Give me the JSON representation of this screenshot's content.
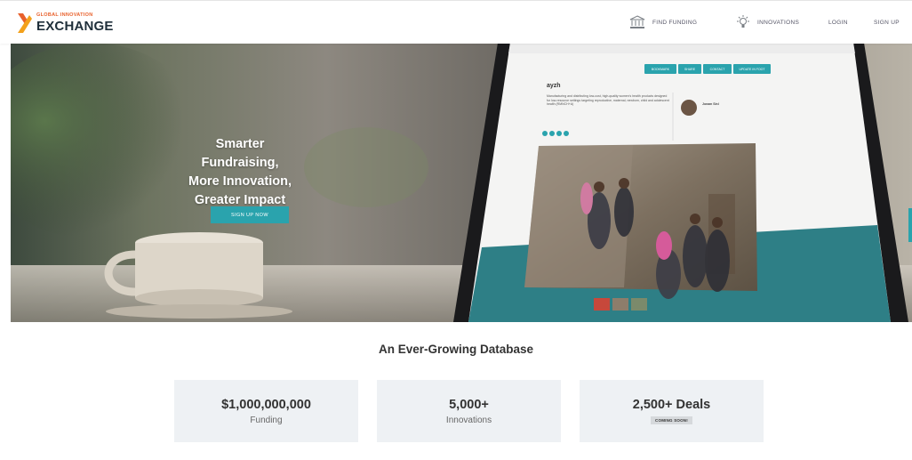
{
  "header": {
    "logo": {
      "small": "GLOBAL INNOVATION",
      "big": "EXCHANGE"
    },
    "nav": [
      {
        "label": "FIND FUNDING",
        "icon": "bank-icon"
      },
      {
        "label": "INNOVATIONS",
        "icon": "lightbulb-icon"
      },
      {
        "label": "LOGIN"
      },
      {
        "label": "SIGN UP"
      }
    ]
  },
  "hero": {
    "title_lines": [
      "Smarter Fundraising,",
      "More Innovation,",
      "Greater Impact"
    ],
    "cta_label": "SIGN UP NOW",
    "mockup": {
      "heading": "ayzh",
      "description": "Manufacturing and distributing low-cost, high-quality women's health products designed for low-resource settings targeting reproductive, maternal, newborn, child and adolescent health (RMNCH+A)",
      "contact_name": "Jonam Sinl",
      "action_buttons": [
        "BOOKMARK",
        "SHARE",
        "CONTACT",
        "UPDATE IN FOOT"
      ]
    }
  },
  "database": {
    "title": "An Ever-Growing Database",
    "stats": [
      {
        "value": "$1,000,000,000",
        "label": "Funding"
      },
      {
        "value": "5,000+",
        "label": "Innovations"
      },
      {
        "value": "2,500+ Deals",
        "badge": "COMING SOON!"
      }
    ]
  },
  "colors": {
    "accent": "#2aa3ad",
    "logo_orange": "#e8612c",
    "card_bg": "#eef1f4"
  }
}
